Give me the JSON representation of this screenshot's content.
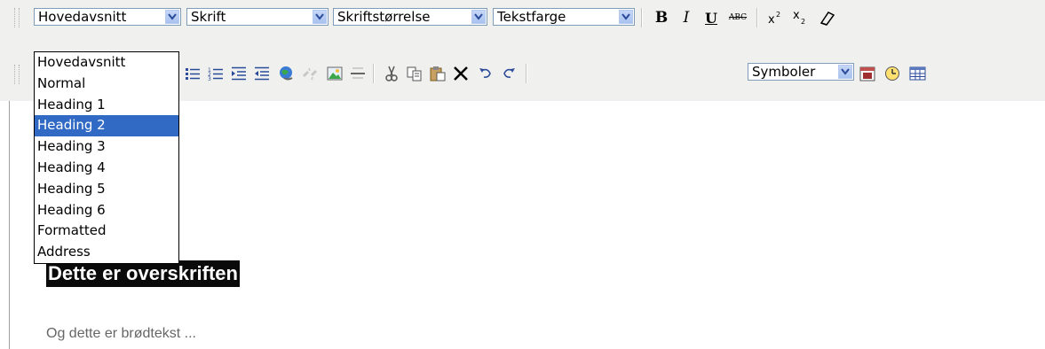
{
  "toolbar": {
    "format_select": "Hovedavsnitt",
    "font_select": "Skrift",
    "size_select": "Skriftstørrelse",
    "color_select": "Tekstfarge",
    "bold": "B",
    "italic": "I",
    "underline": "U",
    "strike": "ABC",
    "symbols_select": "Symboler"
  },
  "dropdown": {
    "options": [
      "Hovedavsnitt",
      "Normal",
      "Heading 1",
      "Heading 2",
      "Heading 3",
      "Heading 4",
      "Heading 5",
      "Heading 6",
      "Formatted",
      "Address"
    ],
    "selected": "Heading 2"
  },
  "editor": {
    "heading": "Dette er overskriften",
    "body": "Og dette er brødtekst ..."
  },
  "colors": {
    "select_border": "#7f9db9",
    "highlight": "#316ac5",
    "toolbar_bg": "#f0f0ee"
  }
}
